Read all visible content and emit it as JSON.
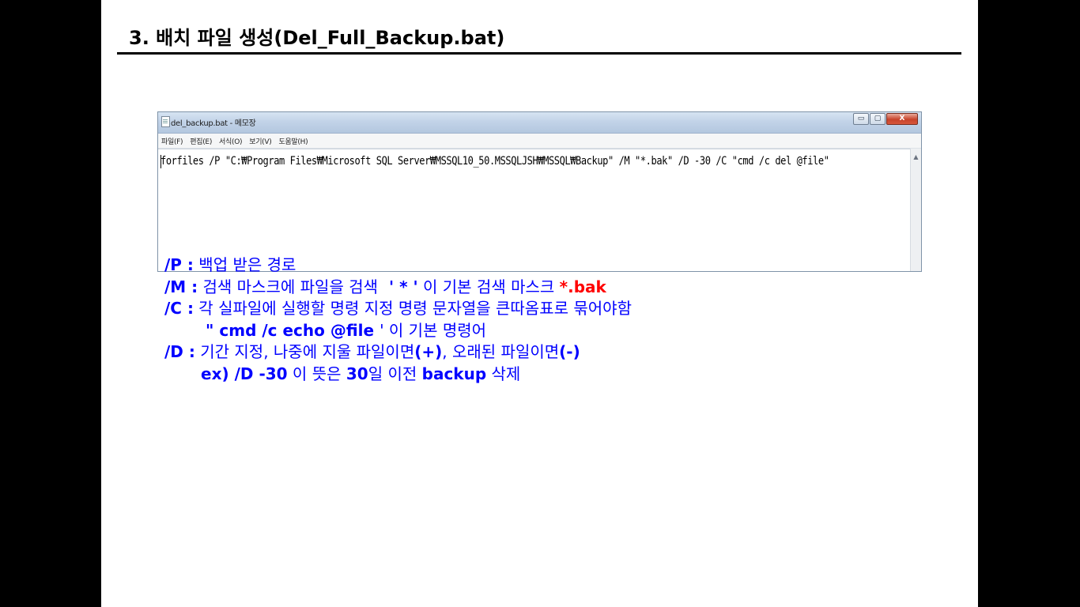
{
  "slide": {
    "title": "3. 배치 파일 생성(Del_Full_Backup.bat)"
  },
  "notepad": {
    "window_title": "del_backup.bat - 메모장",
    "buttons": {
      "minimize": "▭",
      "maximize": "▢",
      "close": "X"
    },
    "menu": [
      "파일(F)",
      "편집(E)",
      "서식(O)",
      "보기(V)",
      "도움말(H)"
    ],
    "content": "forfiles /P \"C:₩Program Files₩Microsoft SQL Server₩MSSQL10_50.MSSQLJSH₩MSSQL₩Backup\" /M \"*.bak\" /D -30 /C \"cmd /c del @file\"",
    "scroll_up_glyph": "▲"
  },
  "explanation": {
    "p_key": "/P :",
    "p_desc": " 백업 받은 경로",
    "m_key": "/M :",
    "m_desc": " 검색 마스크에 파일을 검색",
    "m_quote": "' * '",
    "m_desc2": " 이 기본 검색 마스크 ",
    "m_example": "*.bak",
    "c_key": "/C :",
    "c_desc": " 각 실파일에 실행할 명령 지정 명령 문자열을 큰따옴표로 묶어야함",
    "c_example": "\" cmd /c echo @file ",
    "c_desc2": "' 이 기본 명령어",
    "d_key": "/D :",
    "d_desc": " 기간 지정, 나중에 지울 파일이면",
    "d_plus": "(+)",
    "d_desc2": ", 오래된 파일이면",
    "d_minus": "(-)",
    "ex_prefix": "ex) /D -30",
    "ex_mid": " 이 뜻은 ",
    "ex_num": "30",
    "ex_mid2": "일 이전 ",
    "ex_word": "backup",
    "ex_end": " 삭제"
  }
}
